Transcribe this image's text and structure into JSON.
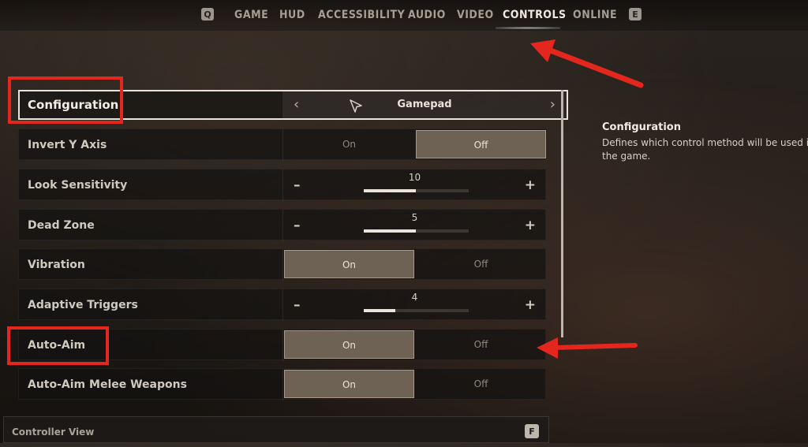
{
  "nav": {
    "left_key": "Q",
    "right_key": "E",
    "tabs": [
      "GAME",
      "HUD",
      "ACCESSIBILITY",
      "AUDIO",
      "VIDEO",
      "CONTROLS",
      "ONLINE"
    ],
    "active_tab": "CONTROLS"
  },
  "settings": {
    "configuration": {
      "label": "Configuration",
      "value": "Gamepad"
    },
    "invert_y": {
      "label": "Invert Y Axis",
      "on": "On",
      "off": "Off",
      "selected": "Off"
    },
    "look_sensitivity": {
      "label": "Look Sensitivity",
      "value": "10",
      "fill_fraction": 0.5
    },
    "dead_zone": {
      "label": "Dead Zone",
      "value": "5",
      "fill_fraction": 0.5
    },
    "vibration": {
      "label": "Vibration",
      "on": "On",
      "off": "Off",
      "selected": "On"
    },
    "adaptive_triggers": {
      "label": "Adaptive Triggers",
      "value": "4",
      "fill_fraction": 0.3
    },
    "auto_aim": {
      "label": "Auto-Aim",
      "on": "On",
      "off": "Off",
      "selected": "On"
    },
    "auto_aim_melee": {
      "label": "Auto-Aim Melee Weapons",
      "on": "On",
      "off": "Off",
      "selected": "On"
    }
  },
  "description": {
    "title": "Configuration",
    "text": "Defines which control method will be used in the game."
  },
  "controller_view": {
    "label": "Controller View",
    "key": "F"
  },
  "colors": {
    "highlight_red": "#e3261e",
    "selected_bg": "#6e6255"
  },
  "icons": [
    "chevron-left-icon",
    "chevron-right-icon",
    "mouse-cursor-icon",
    "minus-icon",
    "plus-icon"
  ]
}
